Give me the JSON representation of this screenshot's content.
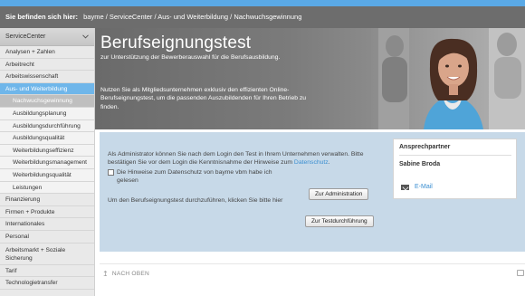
{
  "breadcrumb": {
    "label": "Sie befinden sich hier:",
    "path": "bayme / ServiceCenter / Aus- und Weiterbildung / Nachwuchsgewinnung"
  },
  "sidebar": {
    "header": "ServiceCenter",
    "items": [
      {
        "label": "Analysen + Zahlen"
      },
      {
        "label": "Arbeitrecht"
      },
      {
        "label": "Arbeitswissenschaft"
      },
      {
        "label": "Aus- und Weiterbildung"
      },
      {
        "label": "Nachwuchsgewinnung"
      },
      {
        "label": "Ausbildungsplanung"
      },
      {
        "label": "Ausbildungsdurchführung"
      },
      {
        "label": "Ausbildungsqualität"
      },
      {
        "label": "Weiterbildungseffizienz"
      },
      {
        "label": "Weiterbildungsmanagement"
      },
      {
        "label": "Weiterbildungsqualität"
      },
      {
        "label": "Leistungen"
      },
      {
        "label": "Finanzierung"
      },
      {
        "label": "Firmen + Produkte"
      },
      {
        "label": "Internationales"
      },
      {
        "label": "Personal"
      },
      {
        "label": "Arbeitsmarkt + Soziale Sicherung"
      },
      {
        "label": "Tarif"
      },
      {
        "label": "Technologietransfer"
      }
    ]
  },
  "hero": {
    "title": "Berufseignungstest",
    "subtitle": "zur Unterstützung der Bewerberauswahl für die Berufsausbildung.",
    "text": "Nutzen Sie als Mitgliedsunternehmen exklusiv den effizienten Online-Berufseignungstest, um die passenden Auszubildenden für Ihren Betrieb zu finden."
  },
  "admin": {
    "text_before": "Als Administrator können Sie nach dem Login den Test in Ihrem Unternehmen verwalten. Bitte bestätigen Sie vor dem Login die Kenntnisnahme der Hinweise zum ",
    "link": "Datenschutz",
    "text_after": ".",
    "checkbox_label": "Die Hinweise zum Datenschutz von bayme vbm habe ich gelesen",
    "button": "Zur Administration"
  },
  "test": {
    "text": "Um den Berufseignungstest durchzuführen, klicken Sie bitte hier",
    "button": "Zur Testdurchführung"
  },
  "contact": {
    "heading": "Ansprechpartner",
    "name": "Sabine Broda",
    "email": "E-Mail"
  },
  "footer": {
    "back_to_top": "NACH OBEN"
  },
  "icons": {
    "sidebar_header": "chevron-down-icon",
    "mail": "mail-icon",
    "up": "arrow-up-icon",
    "print": "printer-icon"
  },
  "colors": {
    "accent": "#6fb6ea",
    "link": "#3b8fd1",
    "panel": "#c7d9e8"
  }
}
